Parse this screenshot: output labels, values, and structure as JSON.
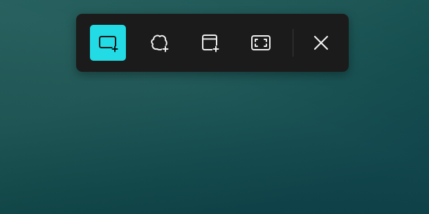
{
  "toolbar": {
    "background_color": "#1b1b1b",
    "accent_color": "#22dbe4",
    "selected_mode": "rectangle",
    "buttons": [
      {
        "id": "rectangle",
        "icon": "rectangle-snip-icon",
        "selected": true
      },
      {
        "id": "freeform",
        "icon": "freeform-snip-icon",
        "selected": false
      },
      {
        "id": "window",
        "icon": "window-snip-icon",
        "selected": false
      },
      {
        "id": "fullscreen",
        "icon": "fullscreen-snip-icon",
        "selected": false
      },
      {
        "id": "close",
        "icon": "close-icon",
        "selected": false
      }
    ]
  },
  "desktop": {
    "background_color": "#124b4d"
  }
}
